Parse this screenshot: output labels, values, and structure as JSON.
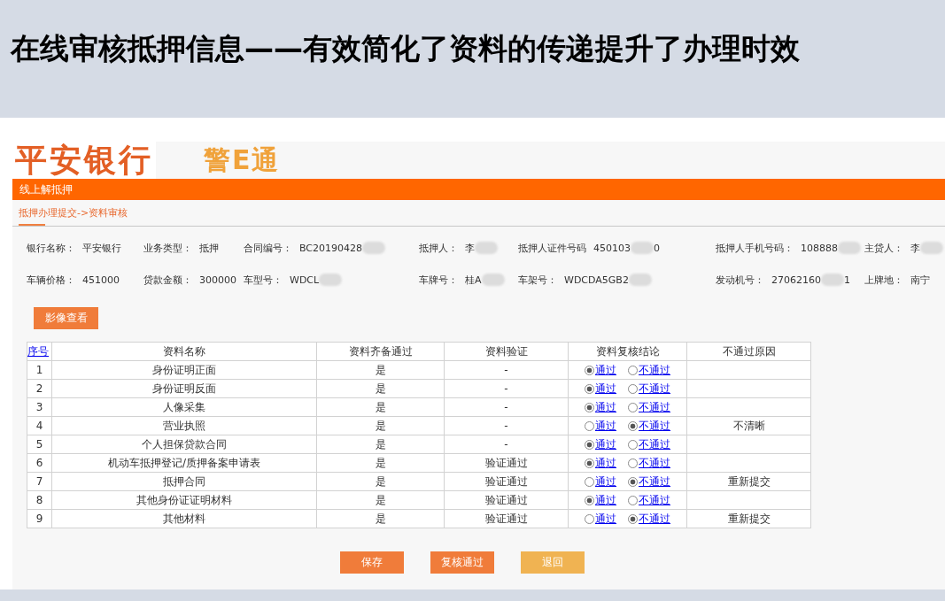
{
  "slide_title": "在线审核抵押信息——有效简化了资料的传递提升了办理时效",
  "app": {
    "logo": {
      "bank_name": "平安银行",
      "product_name": "警E通"
    },
    "nav_bar_title": "线上解抵押",
    "breadcrumb": "抵押办理提交->资料审核",
    "info_rows": [
      [
        {
          "label": "银行名称：",
          "value": "平安银行",
          "redacted": false
        },
        {
          "label": "业务类型：",
          "value": "抵押",
          "redacted": false
        },
        {
          "label": "合同编号：",
          "value": "BC20190428",
          "redacted": true
        },
        {
          "label": "抵押人：",
          "value": "李",
          "redacted": true
        },
        {
          "label": "抵押人证件号码",
          "value": "450103",
          "redacted": true,
          "value_tail": "0"
        },
        {
          "label": "抵押人手机号码：",
          "value": "108888",
          "redacted": true
        },
        {
          "label": "主贷人：",
          "value": "李",
          "redacted": true
        }
      ],
      [
        {
          "label": "车辆价格：",
          "value": "451000",
          "redacted": false
        },
        {
          "label": "贷款金额：",
          "value": "300000",
          "redacted": false
        },
        {
          "label": "车型号：",
          "value": "WDCL",
          "redacted": true
        },
        {
          "label": "车牌号：",
          "value": "桂A",
          "redacted": true
        },
        {
          "label": "车架号：",
          "value": "WDCDA5GB2",
          "redacted": true
        },
        {
          "label": "发动机号：",
          "value": "27062160",
          "redacted": true,
          "value_tail": "1"
        },
        {
          "label": "上牌地：",
          "value": "南宁",
          "redacted": false
        }
      ]
    ],
    "image_view_button": "影像查看",
    "table": {
      "columns": [
        {
          "label": "序号",
          "link": true
        },
        {
          "label": "资料名称",
          "link": false
        },
        {
          "label": "资料齐备通过",
          "link": false
        },
        {
          "label": "资料验证",
          "link": false
        },
        {
          "label": "资料复核结论",
          "link": false
        },
        {
          "label": "不通过原因",
          "link": false
        }
      ],
      "rows": [
        {
          "index": "1",
          "name": "身份证明正面",
          "complete": "是",
          "verification": "-",
          "conclusion": [
            {
              "label": "通过",
              "selected": true
            },
            {
              "label": "不通过",
              "selected": false
            }
          ]
        },
        {
          "index": "2",
          "name": "身份证明反面",
          "complete": "是",
          "verification": "-",
          "conclusion": [
            {
              "label": "通过",
              "selected": true
            },
            {
              "label": "不通过",
              "selected": false
            }
          ]
        },
        {
          "index": "3",
          "name": "人像采集",
          "complete": "是",
          "verification": "-",
          "conclusion": [
            {
              "label": "通过",
              "selected": true
            },
            {
              "label": "不通过",
              "selected": false
            }
          ]
        },
        {
          "index": "4",
          "name": "营业执照",
          "complete": "是",
          "verification": "-",
          "conclusion": [
            {
              "label": "通过",
              "selected": false
            },
            {
              "label": "不通过",
              "selected": true
            }
          ],
          "reason": "不清晰"
        },
        {
          "index": "5",
          "name": "个人担保贷款合同",
          "complete": "是",
          "verification": "-",
          "conclusion": [
            {
              "label": "通过",
              "selected": true
            },
            {
              "label": "不通过",
              "selected": false
            }
          ]
        },
        {
          "index": "6",
          "name": "机动车抵押登记/质押备案申请表",
          "complete": "是",
          "verification": "验证通过",
          "conclusion": [
            {
              "label": "通过",
              "selected": true
            },
            {
              "label": "不通过",
              "selected": false
            }
          ]
        },
        {
          "index": "7",
          "name": "抵押合同",
          "complete": "是",
          "verification": "验证通过",
          "conclusion": [
            {
              "label": "通过",
              "selected": false
            },
            {
              "label": "不通过",
              "selected": true
            }
          ],
          "reason": "重新提交"
        },
        {
          "index": "8",
          "name": "其他身份证证明材料",
          "complete": "是",
          "verification": "验证通过",
          "conclusion": [
            {
              "label": "通过",
              "selected": true
            },
            {
              "label": "不通过",
              "selected": false
            }
          ]
        },
        {
          "index": "9",
          "name": "其他材料",
          "complete": "是",
          "verification": "验证通过",
          "conclusion": [
            {
              "label": "通过",
              "selected": false
            },
            {
              "label": "不通过",
              "selected": true
            }
          ],
          "reason": "重新提交"
        }
      ]
    },
    "buttons": [
      {
        "label": "保存",
        "kind": "primary"
      },
      {
        "label": "复核通过",
        "kind": "primary"
      },
      {
        "label": "退回",
        "kind": "secondary"
      }
    ]
  }
}
